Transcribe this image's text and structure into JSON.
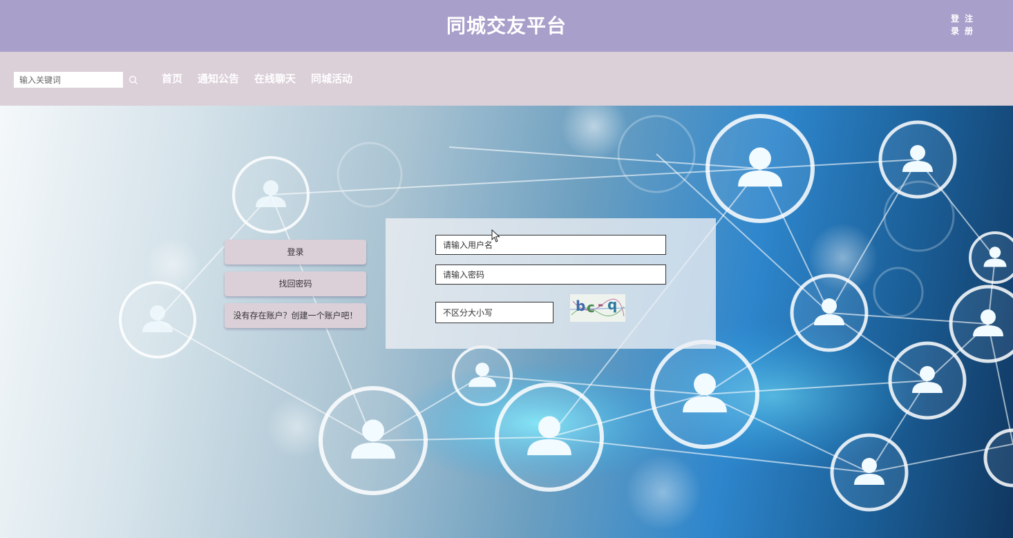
{
  "header": {
    "title": "同城交友平台",
    "login_label": "登录",
    "register_label": "注册"
  },
  "nav": {
    "search_placeholder": "输入关键词",
    "search_icon": "search-icon",
    "links": [
      "首页",
      "通知公告",
      "在线聊天",
      "同城活动"
    ]
  },
  "side_buttons": {
    "login": "登录",
    "recover": "找回密码",
    "signup": "没有存在账户？创建一个账户吧！"
  },
  "login_form": {
    "username_placeholder": "请输入用户名",
    "password_placeholder": "请输入密码",
    "captcha_placeholder": "不区分大小写",
    "captcha_text": "bc-q"
  },
  "colors": {
    "header_bg": "#a89fca",
    "nav_bg": "#dbcfd8",
    "button_bg": "#dbcfd8"
  }
}
